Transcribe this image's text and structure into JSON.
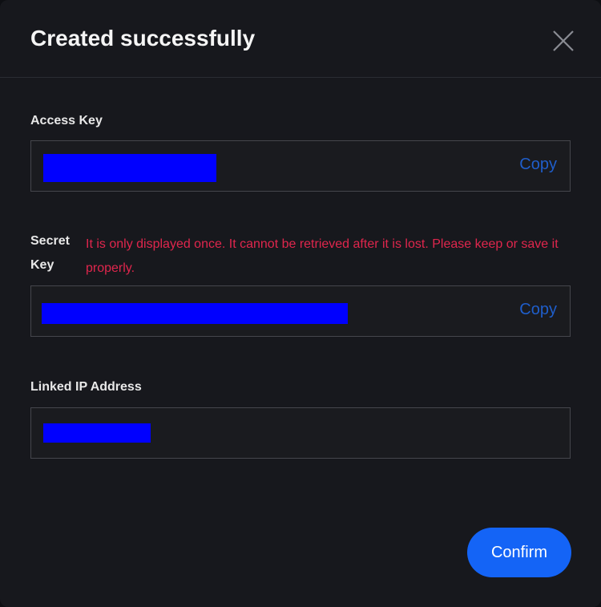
{
  "dialog": {
    "title": "Created successfully",
    "close_icon": "close-icon",
    "access_key": {
      "label": "Access Key",
      "copy_label": "Copy"
    },
    "secret_key": {
      "label_line1": "Secret",
      "label_line2": "Key",
      "warning": "It is only displayed once. It cannot be retrieved after it is lost. Please keep or save it properly.",
      "copy_label": "Copy"
    },
    "linked_ip": {
      "label": "Linked IP Address"
    },
    "confirm_label": "Confirm",
    "colors": {
      "accent": "#1464f6",
      "warning": "#e0264d",
      "link": "#1f5ecb",
      "background": "#17181d"
    }
  }
}
